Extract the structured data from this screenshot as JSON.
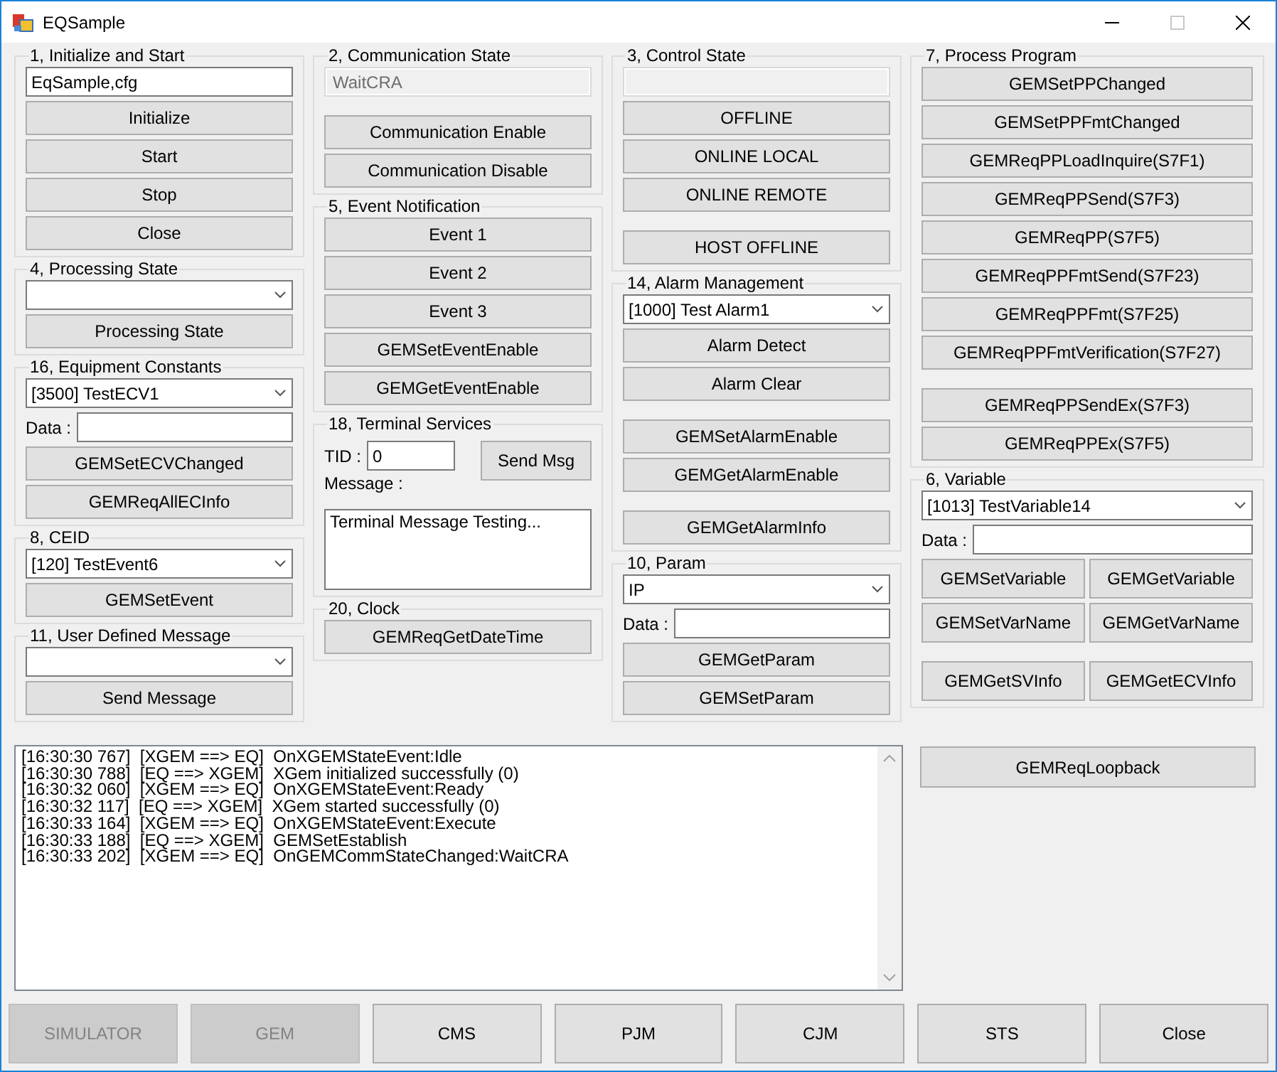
{
  "window": {
    "title": "EQSample",
    "controls": [
      {
        "kind": "minimize",
        "disabled": false
      },
      {
        "kind": "maximize",
        "disabled": true
      },
      {
        "kind": "close",
        "disabled": false
      }
    ]
  },
  "columns": [
    [
      {
        "title": "1, Initialize and Start",
        "items": [
          {
            "kind": "text_field",
            "value": "EqSample,cfg"
          },
          {
            "kind": "button",
            "label": "Initialize"
          },
          {
            "kind": "button",
            "label": "Start"
          },
          {
            "kind": "button",
            "label": "Stop"
          },
          {
            "kind": "button",
            "label": "Close"
          }
        ]
      },
      {
        "title": "4, Processing State",
        "items": [
          {
            "kind": "combo"
          },
          {
            "kind": "button",
            "label": "Processing State"
          }
        ]
      },
      {
        "title": "16, Equipment Constants",
        "items": [
          {
            "kind": "combo",
            "value": "[3500]  TestECV1"
          },
          {
            "kind": "data_field",
            "label": "Data :"
          },
          {
            "kind": "button",
            "label": "GEMSetECVChanged"
          },
          {
            "kind": "button",
            "label": "GEMReqAllECInfo"
          }
        ]
      },
      {
        "title": "8, CEID",
        "items": [
          {
            "kind": "combo",
            "value": "[120]  TestEvent6"
          },
          {
            "kind": "button",
            "label": "GEMSetEvent"
          }
        ]
      },
      {
        "title": "11, User Defined Message",
        "items": [
          {
            "kind": "combo"
          },
          {
            "kind": "button",
            "label": "Send Message"
          }
        ]
      }
    ],
    [
      {
        "title": "2, Communication State",
        "items": [
          {
            "kind": "readonly_field",
            "value": "WaitCRA"
          },
          {
            "kind": "spacer"
          },
          {
            "kind": "button",
            "label": "Communication Enable"
          },
          {
            "kind": "button",
            "label": "Communication Disable"
          }
        ]
      },
      {
        "title": "5, Event Notification",
        "items": [
          {
            "kind": "button",
            "label": "Event 1"
          },
          {
            "kind": "button",
            "label": "Event 2"
          },
          {
            "kind": "button",
            "label": "Event 3"
          },
          {
            "kind": "button",
            "label": "GEMSetEventEnable"
          },
          {
            "kind": "button",
            "label": "GEMGetEventEnable"
          }
        ]
      },
      {
        "title": "18, Terminal Services",
        "items": [
          {
            "kind": "terminal",
            "tid_label": "TID :",
            "tid_value": "0",
            "send_label": "Send Msg",
            "message_label": "Message :",
            "message_value": "Terminal Message Testing..."
          }
        ]
      },
      {
        "title": "20, Clock",
        "items": [
          {
            "kind": "button",
            "label": "GEMReqGetDateTime"
          }
        ]
      }
    ],
    [
      {
        "title": "3, Control State",
        "items": [
          {
            "kind": "readonly_field"
          },
          {
            "kind": "button",
            "label": "OFFLINE"
          },
          {
            "kind": "button",
            "label": "ONLINE LOCAL"
          },
          {
            "kind": "button",
            "label": "ONLINE REMOTE"
          },
          {
            "kind": "spacer"
          },
          {
            "kind": "button",
            "label": "HOST OFFLINE"
          }
        ]
      },
      {
        "title": "14, Alarm Management",
        "items": [
          {
            "kind": "combo",
            "value": "[1000]  Test Alarm1"
          },
          {
            "kind": "button",
            "label": "Alarm Detect"
          },
          {
            "kind": "button",
            "label": "Alarm Clear"
          },
          {
            "kind": "spacer"
          },
          {
            "kind": "button",
            "label": "GEMSetAlarmEnable"
          },
          {
            "kind": "button",
            "label": "GEMGetAlarmEnable"
          },
          {
            "kind": "spacer"
          },
          {
            "kind": "button",
            "label": "GEMGetAlarmInfo"
          }
        ]
      },
      {
        "title": "10, Param",
        "items": [
          {
            "kind": "combo",
            "value": "IP"
          },
          {
            "kind": "data_field",
            "label": "Data :"
          },
          {
            "kind": "button",
            "label": "GEMGetParam"
          },
          {
            "kind": "button",
            "label": "GEMSetParam"
          }
        ]
      }
    ],
    [
      {
        "title": "7, Process Program",
        "items": [
          {
            "kind": "button",
            "label": "GEMSetPPChanged"
          },
          {
            "kind": "button",
            "label": "GEMSetPPFmtChanged"
          },
          {
            "kind": "button",
            "label": "GEMReqPPLoadInquire(S7F1)"
          },
          {
            "kind": "button",
            "label": "GEMReqPPSend(S7F3)"
          },
          {
            "kind": "button",
            "label": "GEMReqPP(S7F5)"
          },
          {
            "kind": "button",
            "label": "GEMReqPPFmtSend(S7F23)"
          },
          {
            "kind": "button",
            "label": "GEMReqPPFmt(S7F25)"
          },
          {
            "kind": "button",
            "label": "GEMReqPPFmtVerification(S7F27)"
          },
          {
            "kind": "spacer"
          },
          {
            "kind": "button",
            "label": "GEMReqPPSendEx(S7F3)"
          },
          {
            "kind": "button",
            "label": "GEMReqPPEx(S7F5)"
          }
        ]
      },
      {
        "title": "6, Variable",
        "items": [
          {
            "kind": "combo",
            "value": "[1013]  TestVariable14"
          },
          {
            "kind": "data_field",
            "label": "Data :"
          },
          {
            "kind": "button_pair",
            "labels": [
              "GEMSetVariable",
              "GEMGetVariable"
            ]
          },
          {
            "kind": "button_pair",
            "labels": [
              "GEMSetVarName",
              "GEMGetVarName"
            ]
          },
          {
            "kind": "spacer"
          },
          {
            "kind": "button_pair",
            "labels": [
              "GEMGetSVInfo",
              "GEMGetECVInfo"
            ]
          }
        ]
      }
    ]
  ],
  "log": {
    "lines": [
      "[16:30:30 767]  [XGEM ==> EQ]  OnXGEMStateEvent:Idle",
      "[16:30:30 788]  [EQ ==> XGEM]  XGem initialized successfully (0)",
      "[16:30:32 060]  [XGEM ==> EQ]  OnXGEMStateEvent:Ready",
      "[16:30:32 117]  [EQ ==> XGEM]  XGem started successfully (0)",
      "[16:30:33 164]  [XGEM ==> EQ]  OnXGEMStateEvent:Execute",
      "[16:30:33 188]  [EQ ==> XGEM]  GEMSetEstablish",
      "[16:30:33 202]  [XGEM ==> EQ]  OnGEMCommStateChanged:WaitCRA"
    ]
  },
  "side_button": "GEMReqLoopback",
  "bottom_buttons": [
    {
      "label": "SIMULATOR",
      "disabled": true
    },
    {
      "label": "GEM",
      "disabled": true
    },
    {
      "label": "CMS",
      "disabled": false
    },
    {
      "label": "PJM",
      "disabled": false
    },
    {
      "label": "CJM",
      "disabled": false
    },
    {
      "label": "STS",
      "disabled": false
    },
    {
      "label": "Close",
      "disabled": false
    }
  ]
}
